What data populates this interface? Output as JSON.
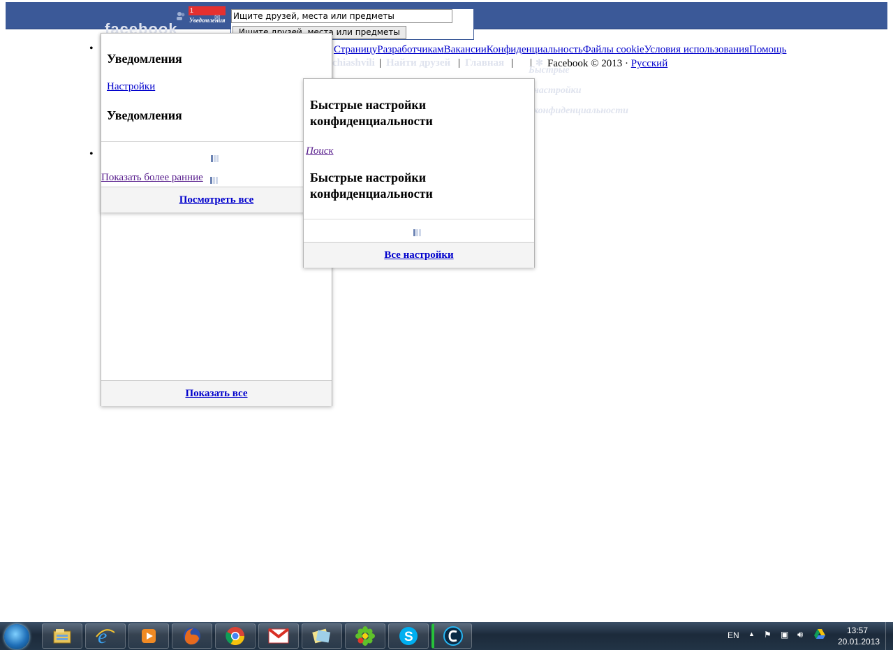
{
  "header": {
    "logo_ghost": "facebook",
    "notifications_badge": "1",
    "notifications_label": "Уведомления",
    "search_value": "Ищите друзей, места или предметы",
    "search_button": "Ищите друзей, места или предметы"
  },
  "footer": {
    "links": [
      "Страницу",
      "Разработчикам",
      "Вакансии",
      "Конфиденциальность",
      "Файлы cookie",
      "Условия использования",
      "Помощь"
    ],
    "copyright": "Facebook © 2013 ·",
    "language": "Русский"
  },
  "ghost_nav": {
    "username": "chiashvili",
    "find_friends": "Найти друзей",
    "home": "Главная",
    "ghost_1": "Быстрые",
    "ghost_2": "настройки",
    "ghost_3": "конфиденциальности"
  },
  "notifications_flyout": {
    "title": "Уведомления",
    "settings_link": "Настройки",
    "subtitle": "Уведомления",
    "show_earlier": "Показать более ранние",
    "see_all": "Посмотреть все",
    "show_all": "Показать все"
  },
  "privacy_flyout": {
    "title": "Быстрые настройки конфиденциальности",
    "search_link": "Поиск",
    "subtitle": "Быстрые настройки конфиденциальности",
    "all_settings": "Все настройки"
  },
  "taskbar": {
    "lang": "EN",
    "time": "13:57",
    "date": "20.01.2013",
    "apps": [
      "explorer",
      "internet-explorer",
      "media-player",
      "firefox",
      "chrome",
      "gmail",
      "notes",
      "icq",
      "skype",
      "cyberlink"
    ]
  },
  "colors": {
    "fb_blue": "#3b5998",
    "badge_red": "#e5302f",
    "link": "#0000cc"
  }
}
